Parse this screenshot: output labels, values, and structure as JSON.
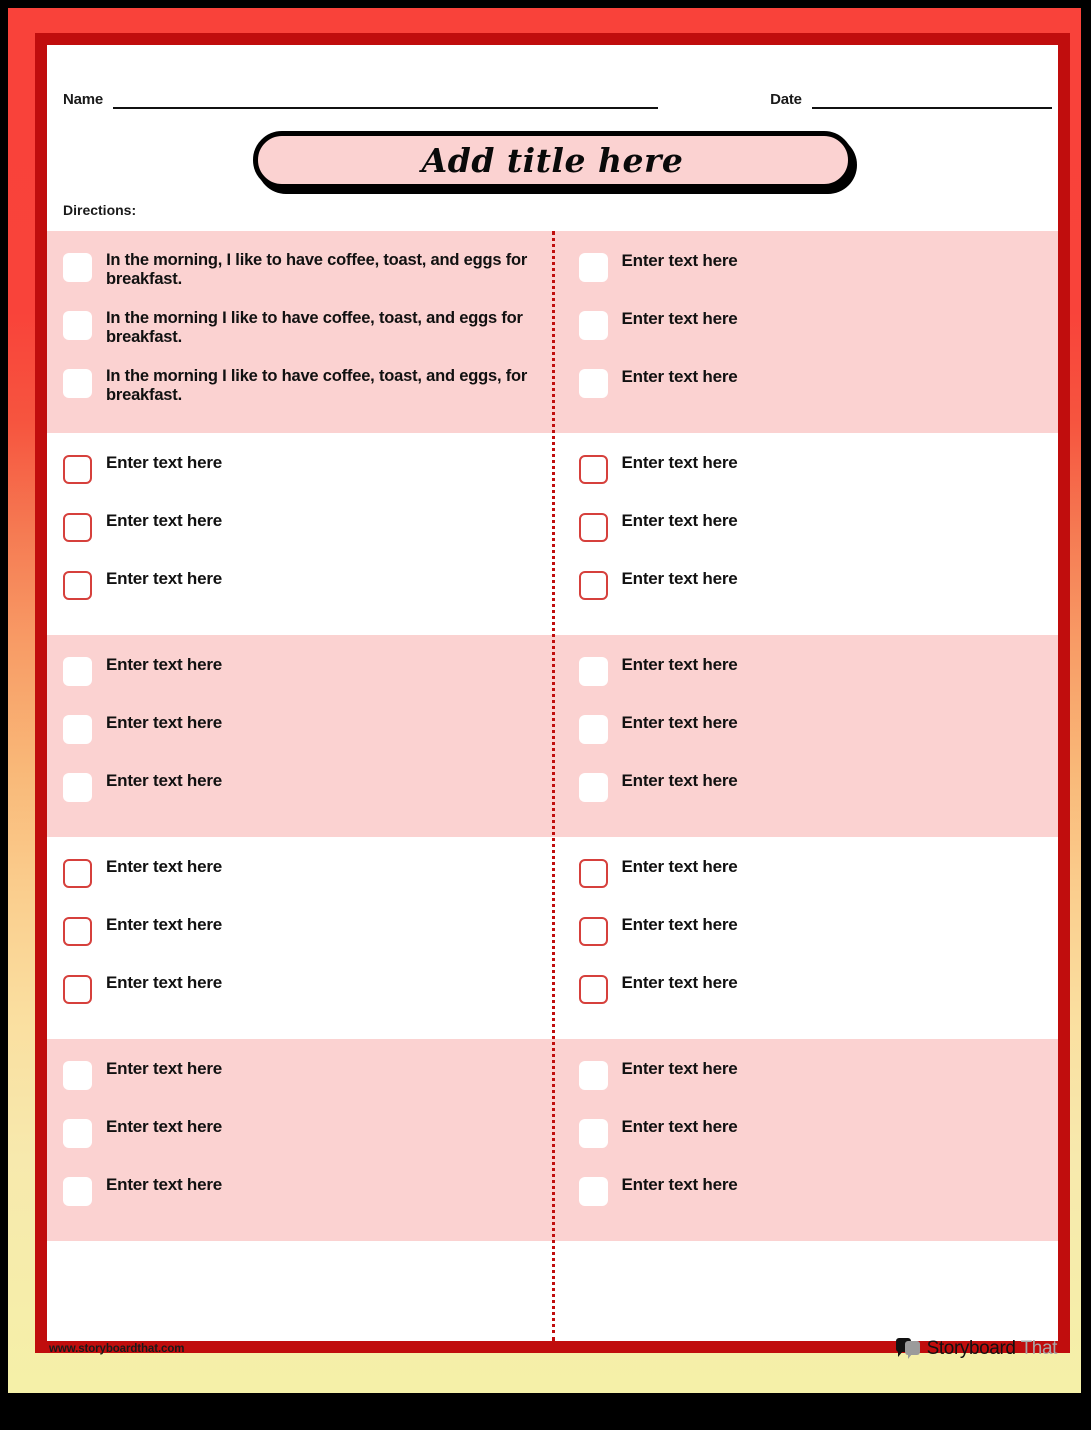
{
  "theme": {
    "frame_gradient_top": "#F9423A",
    "frame_gradient_mid": "#F9B878",
    "frame_gradient_bottom": "#F5F0A8",
    "inner_border": "#C00D0D",
    "band_pink": "#FBD2D1",
    "checkbox_outline": "#D6403C",
    "text": "#111111"
  },
  "header": {
    "name_label": "Name",
    "date_label": "Date",
    "title": "Add title here",
    "directions_label": "Directions:"
  },
  "placeholders": {
    "row_placeholder": "Enter text here"
  },
  "blocks": [
    {
      "style": "shaded",
      "left": [
        "In the morning, I like to have coffee, toast, and eggs for breakfast.",
        "In the morning I like to have coffee, toast, and eggs for breakfast.",
        "In the morning I like to have coffee, toast, and eggs, for breakfast."
      ],
      "right": [
        "Enter text here",
        "Enter text here",
        "Enter text here"
      ]
    },
    {
      "style": "plain",
      "left": [
        "Enter text here",
        "Enter text here",
        "Enter text here"
      ],
      "right": [
        "Enter text here",
        "Enter text here",
        "Enter text here"
      ]
    },
    {
      "style": "shaded",
      "left": [
        "Enter text here",
        "Enter text here",
        "Enter text here"
      ],
      "right": [
        "Enter text here",
        "Enter text here",
        "Enter text here"
      ]
    },
    {
      "style": "plain",
      "left": [
        "Enter text here",
        "Enter text here",
        "Enter text here"
      ],
      "right": [
        "Enter text here",
        "Enter text here",
        "Enter text here"
      ]
    },
    {
      "style": "shaded",
      "left": [
        "Enter text here",
        "Enter text here",
        "Enter text here"
      ],
      "right": [
        "Enter text here",
        "Enter text here",
        "Enter text here"
      ]
    }
  ],
  "footer": {
    "url": "www.storyboardthat.com",
    "logo_primary": "Storyboard",
    "logo_secondary": "That",
    "logo_icon": "speech-bubbles-icon"
  }
}
